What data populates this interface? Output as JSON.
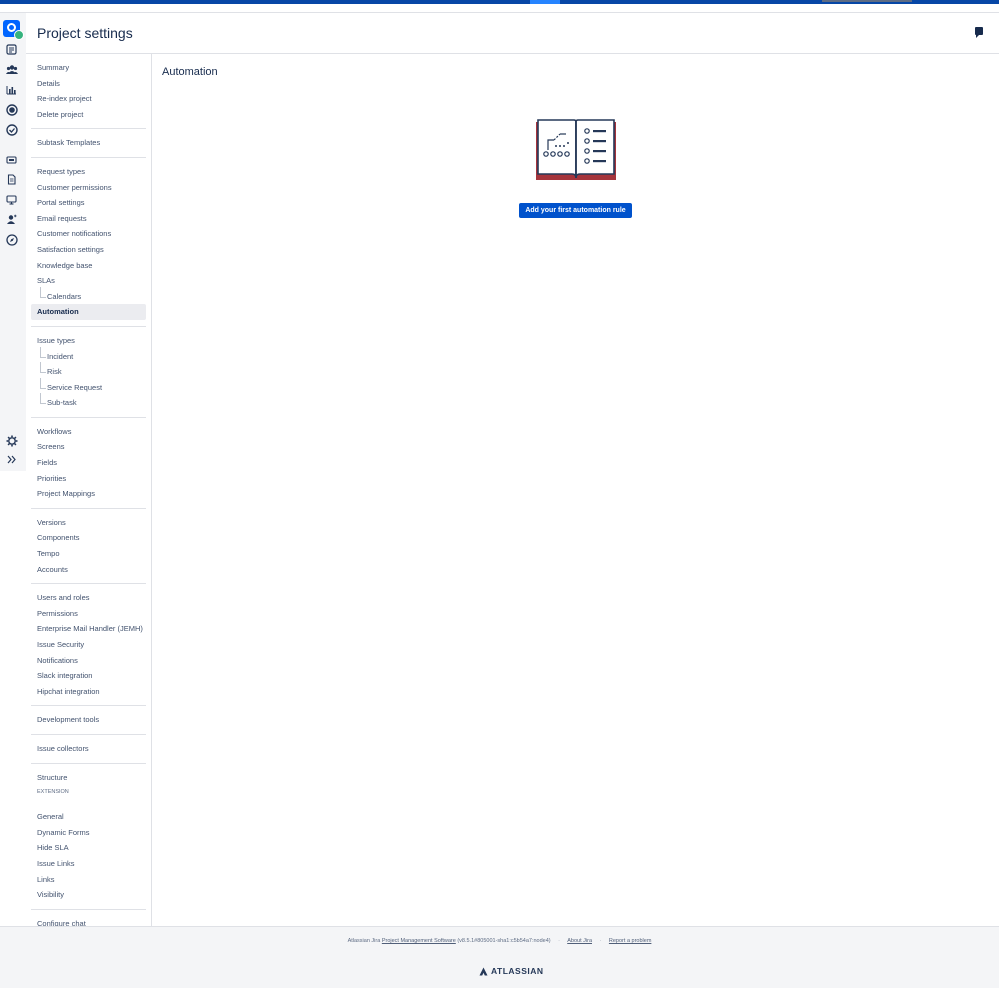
{
  "header": {
    "title": "Project settings"
  },
  "rail": {
    "icons": [
      "project-avatar-icon",
      "queues-icon",
      "customers-icon",
      "reports-icon",
      "raise-request-icon",
      "sla-icon",
      "channels-icon",
      "invite-team-icon",
      "knowledge-base-icon",
      "portal-icon",
      "people-icon",
      "explore-icon",
      "settings-icon",
      "expand-icon"
    ]
  },
  "sidebar": {
    "groups": [
      {
        "items": [
          {
            "label": "Summary"
          },
          {
            "label": "Details"
          },
          {
            "label": "Re-index project"
          },
          {
            "label": "Delete project"
          }
        ]
      },
      {
        "items": [
          {
            "label": "Subtask Templates"
          }
        ]
      },
      {
        "items": [
          {
            "label": "Request types"
          },
          {
            "label": "Customer permissions"
          },
          {
            "label": "Portal settings"
          },
          {
            "label": "Email requests"
          },
          {
            "label": "Customer notifications"
          },
          {
            "label": "Satisfaction settings"
          },
          {
            "label": "Knowledge base"
          },
          {
            "label": "SLAs"
          },
          {
            "label": "Calendars",
            "sub": true
          },
          {
            "label": "Automation",
            "active": true
          }
        ]
      },
      {
        "items": [
          {
            "label": "Issue types"
          },
          {
            "label": "Incident",
            "sub": true
          },
          {
            "label": "Risk",
            "sub": true
          },
          {
            "label": "Service Request",
            "sub": true
          },
          {
            "label": "Sub-task",
            "sub": true
          }
        ]
      },
      {
        "items": [
          {
            "label": "Workflows"
          },
          {
            "label": "Screens"
          },
          {
            "label": "Fields"
          },
          {
            "label": "Priorities"
          },
          {
            "label": "Project Mappings"
          }
        ]
      },
      {
        "items": [
          {
            "label": "Versions"
          },
          {
            "label": "Components"
          },
          {
            "label": "Tempo"
          },
          {
            "label": "Accounts"
          }
        ]
      },
      {
        "items": [
          {
            "label": "Users and roles"
          },
          {
            "label": "Permissions"
          },
          {
            "label": "Enterprise Mail Handler (JEMH)"
          },
          {
            "label": "Issue Security"
          },
          {
            "label": "Notifications"
          },
          {
            "label": "Slack integration"
          },
          {
            "label": "Hipchat integration"
          }
        ]
      },
      {
        "items": [
          {
            "label": "Development tools"
          }
        ]
      },
      {
        "items": [
          {
            "label": "Issue collectors"
          }
        ]
      },
      {
        "heading": "EXTENSION",
        "items": [
          {
            "label": "Structure"
          }
        ]
      },
      {
        "items": [
          {
            "label": "General"
          },
          {
            "label": "Dynamic Forms"
          },
          {
            "label": "Hide SLA"
          },
          {
            "label": "Issue Links"
          },
          {
            "label": "Links"
          },
          {
            "label": "Visibility"
          }
        ]
      },
      {
        "items": [
          {
            "label": "Configure chat"
          }
        ]
      }
    ]
  },
  "main": {
    "title": "Automation",
    "illustration": "automation-book-icon",
    "add_button": "Add your first automation rule"
  },
  "footer": {
    "prefix": "Atlassian Jira",
    "pms_link": "Project Management Software",
    "version": "(v8.5.1#805001-sha1:c5b54a7:node4)",
    "about": "About Jira",
    "report": "Report a problem",
    "logo": "ATLASSIAN"
  }
}
